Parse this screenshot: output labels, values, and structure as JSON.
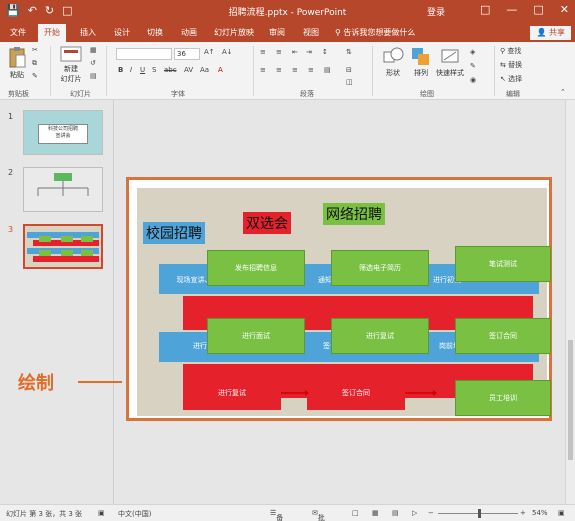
{
  "titlebar": {
    "title": "招聘流程.pptx - PowerPoint",
    "login": "登录",
    "qat": [
      "save-icon",
      "undo-icon",
      "redo-icon",
      "present-icon"
    ]
  },
  "tabs": [
    {
      "label": "文件"
    },
    {
      "label": "开始"
    },
    {
      "label": "插入"
    },
    {
      "label": "设计"
    },
    {
      "label": "切换"
    },
    {
      "label": "动画"
    },
    {
      "label": "幻灯片放映"
    },
    {
      "label": "审阅"
    },
    {
      "label": "视图"
    }
  ],
  "tellme": "告诉我您想要做什么",
  "share": "共享",
  "ribbon": {
    "paste": "粘贴",
    "new_slide": "新建\n幻灯片",
    "font_size": "36",
    "shape": "形状",
    "arrange": "排列",
    "quick_styles": "快速样式",
    "find": "查找",
    "replace": "替换",
    "select": "选择",
    "groups": {
      "clipboard": "剪贴板",
      "slides": "幻灯片",
      "font": "字体",
      "paragraph": "段落",
      "drawing": "绘图",
      "editing": "编辑"
    }
  },
  "thumbnails": [
    {
      "num": "1",
      "text": "科技公司招聘\n宣讲会"
    },
    {
      "num": "2",
      "text": ""
    },
    {
      "num": "3",
      "text": ""
    }
  ],
  "slide": {
    "headers": {
      "campus": "校园招聘",
      "fair": "双选会",
      "online": "网络招聘"
    },
    "boxes": {
      "publish": "发布招聘信息",
      "collect": "筛选电子简历",
      "written": "笔试测试",
      "present": "现场宣讲、筛选简历",
      "notify": "通知面试",
      "interview": "进行初试",
      "interview1": "进行面试",
      "interview2": "进行复试",
      "contract1": "签订合同",
      "campus_retest": "进行复试",
      "sign": "签订合同",
      "train": "岗前培训",
      "final": "进行复试",
      "contract2": "签订合同",
      "staff": "员工培训"
    }
  },
  "annotation": "绘制",
  "status": {
    "slide_info": "幻灯片 第 3 张，共 3 张",
    "lang": "中文(中国)",
    "notes": "备注",
    "comments": "批注",
    "zoom": "54%"
  },
  "colors": {
    "brand": "#b7472a",
    "blue": "#4ea3d8",
    "red": "#e5212b",
    "green": "#7ac143",
    "accent": "#e06d2a"
  }
}
